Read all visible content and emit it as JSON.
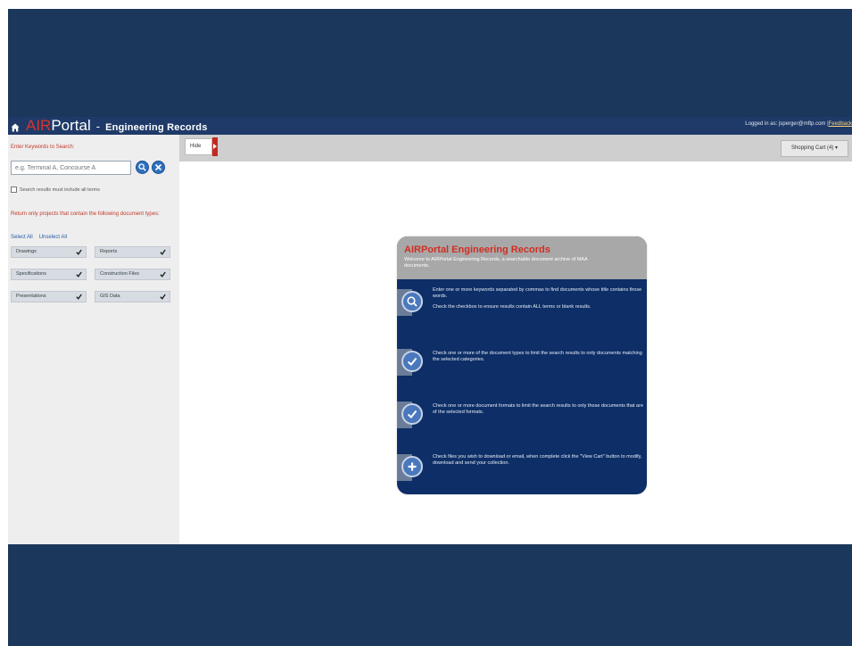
{
  "topbar": {
    "brand_air": "AIR",
    "brand_portal": "Portal",
    "brand_dash": "-",
    "brand_section": "Engineering Records",
    "login_text": "Logged in as: jsperger@mftp.com |",
    "feedback_link": "Feedback"
  },
  "sidebar": {
    "keywords_label": "Enter Keywords to Search:",
    "search_placeholder": "e.g. Terminal A, Concourse A",
    "all_terms_label": "Search results must include all terms",
    "return_text": "Return only projects that contain the following document types:",
    "select_all": "Select All",
    "unselect_all": "Unselect All",
    "doc_types": [
      {
        "label": "Drawings",
        "checked": true
      },
      {
        "label": "Reports",
        "checked": true
      },
      {
        "label": "Specifications",
        "checked": true
      },
      {
        "label": "Construction Files",
        "checked": true
      },
      {
        "label": "Presentations",
        "checked": true
      },
      {
        "label": "GIS Data",
        "checked": true
      }
    ]
  },
  "toolbar": {
    "hide_label": "Hide",
    "cart_label": "Shopping Cart (4) ▾"
  },
  "welcome": {
    "title": "AIRPortal Engineering Records",
    "subtitle": "Welcome to AIRPortal Engineering Records, a searchable document archive of MAA documents.",
    "steps": [
      {
        "icon": "search-icon",
        "text1": "Enter one or more keywords separated by commas to find documents whose title contains those words.",
        "text2": "Check the checkbox to ensure results contain ALL terms or blank results."
      },
      {
        "icon": "checkmark-icon",
        "text1": "Check one or more of the document types to limit the search results to only documents matching the selected categories.",
        "text2": ""
      },
      {
        "icon": "checkmark-icon",
        "text1": "Check one or more document formats to limit the search results to only those documents that are of the selected formats.",
        "text2": ""
      },
      {
        "icon": "plus-icon",
        "text1": "Check files you wish to download or email, when complete click the \"View Cart\" button to modify, download and send your collection.",
        "text2": ""
      }
    ]
  },
  "colors": {
    "slide_bg": "#1c375c",
    "topbar_bg": "#1f3a68",
    "accent_red": "#cf2e22",
    "panel_bg": "#0d2e66"
  }
}
